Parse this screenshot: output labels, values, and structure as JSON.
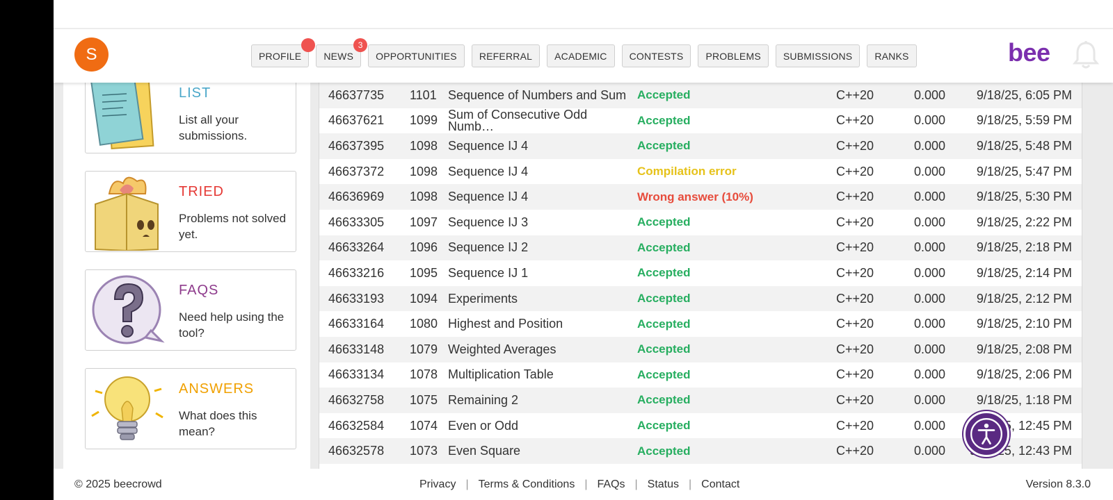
{
  "header": {
    "avatar_letter": "S",
    "logo": "bee",
    "nav": [
      {
        "label": "PROFILE",
        "badge": ""
      },
      {
        "label": "NEWS",
        "badge": "3"
      },
      {
        "label": "OPPORTUNITIES",
        "badge": ""
      },
      {
        "label": "REFERRAL",
        "badge": ""
      },
      {
        "label": "ACADEMIC",
        "badge": ""
      },
      {
        "label": "CONTESTS",
        "badge": ""
      },
      {
        "label": "PROBLEMS",
        "badge": ""
      },
      {
        "label": "SUBMISSIONS",
        "badge": ""
      },
      {
        "label": "RANKS",
        "badge": ""
      }
    ],
    "icons": {
      "bell": "bell-icon",
      "avatar": "user-avatar"
    }
  },
  "sidebar": {
    "cards": [
      {
        "title": "LIST",
        "desc": "List all your submissions.",
        "color": "#4aa7c9",
        "icon": "list-papers-icon"
      },
      {
        "title": "TRIED",
        "desc": "Problems not solved yet.",
        "color": "#e53935",
        "icon": "box-fire-icon"
      },
      {
        "title": "FAQS",
        "desc": "Need help using the tool?",
        "color": "#8e3b8c",
        "icon": "question-bubble-icon"
      },
      {
        "title": "ANSWERS",
        "desc": "What does this mean?",
        "color": "#f0a000",
        "icon": "lightbulb-icon"
      }
    ]
  },
  "submissions": [
    {
      "id": "46637735",
      "pid": "1101",
      "name": "Sequence of Numbers and Sum",
      "status": "Accepted",
      "status_type": "acc",
      "lang": "C++20",
      "time": "0.000",
      "date": "9/18/25, 6:05 PM"
    },
    {
      "id": "46637621",
      "pid": "1099",
      "name": "Sum of Consecutive Odd Numb…",
      "status": "Accepted",
      "status_type": "acc",
      "lang": "C++20",
      "time": "0.000",
      "date": "9/18/25, 5:59 PM"
    },
    {
      "id": "46637395",
      "pid": "1098",
      "name": "Sequence IJ 4",
      "status": "Accepted",
      "status_type": "acc",
      "lang": "C++20",
      "time": "0.000",
      "date": "9/18/25, 5:48 PM"
    },
    {
      "id": "46637372",
      "pid": "1098",
      "name": "Sequence IJ 4",
      "status": "Compilation error",
      "status_type": "ce",
      "lang": "C++20",
      "time": "0.000",
      "date": "9/18/25, 5:47 PM"
    },
    {
      "id": "46636969",
      "pid": "1098",
      "name": "Sequence IJ 4",
      "status": "Wrong answer (10%)",
      "status_type": "wa",
      "lang": "C++20",
      "time": "0.000",
      "date": "9/18/25, 5:30 PM"
    },
    {
      "id": "46633305",
      "pid": "1097",
      "name": "Sequence IJ 3",
      "status": "Accepted",
      "status_type": "acc",
      "lang": "C++20",
      "time": "0.000",
      "date": "9/18/25, 2:22 PM"
    },
    {
      "id": "46633264",
      "pid": "1096",
      "name": "Sequence IJ 2",
      "status": "Accepted",
      "status_type": "acc",
      "lang": "C++20",
      "time": "0.000",
      "date": "9/18/25, 2:18 PM"
    },
    {
      "id": "46633216",
      "pid": "1095",
      "name": "Sequence IJ 1",
      "status": "Accepted",
      "status_type": "acc",
      "lang": "C++20",
      "time": "0.000",
      "date": "9/18/25, 2:14 PM"
    },
    {
      "id": "46633193",
      "pid": "1094",
      "name": "Experiments",
      "status": "Accepted",
      "status_type": "acc",
      "lang": "C++20",
      "time": "0.000",
      "date": "9/18/25, 2:12 PM"
    },
    {
      "id": "46633164",
      "pid": "1080",
      "name": "Highest and Position",
      "status": "Accepted",
      "status_type": "acc",
      "lang": "C++20",
      "time": "0.000",
      "date": "9/18/25, 2:10 PM"
    },
    {
      "id": "46633148",
      "pid": "1079",
      "name": "Weighted Averages",
      "status": "Accepted",
      "status_type": "acc",
      "lang": "C++20",
      "time": "0.000",
      "date": "9/18/25, 2:08 PM"
    },
    {
      "id": "46633134",
      "pid": "1078",
      "name": "Multiplication Table",
      "status": "Accepted",
      "status_type": "acc",
      "lang": "C++20",
      "time": "0.000",
      "date": "9/18/25, 2:06 PM"
    },
    {
      "id": "46632758",
      "pid": "1075",
      "name": "Remaining 2",
      "status": "Accepted",
      "status_type": "acc",
      "lang": "C++20",
      "time": "0.000",
      "date": "9/18/25, 1:18 PM"
    },
    {
      "id": "46632584",
      "pid": "1074",
      "name": "Even or Odd",
      "status": "Accepted",
      "status_type": "acc",
      "lang": "C++20",
      "time": "0.000",
      "date": "9/18/25, 12:45 PM"
    },
    {
      "id": "46632578",
      "pid": "1073",
      "name": "Even Square",
      "status": "Accepted",
      "status_type": "acc",
      "lang": "C++20",
      "time": "0.000",
      "date": "9/18/25, 12:43 PM"
    }
  ],
  "footer": {
    "copyright": "© 2025 beecrowd",
    "links": [
      "Privacy",
      "Terms & Conditions",
      "FAQs",
      "Status",
      "Contact"
    ],
    "version": "Version 8.3.0"
  },
  "colors": {
    "brand": "#7b2fae",
    "accepted": "#27ae60",
    "compile_error": "#e6c21a",
    "wrong_answer": "#e74c3c",
    "avatar": "#f06c13",
    "accessibility": "#5a2a82"
  },
  "a11y_icon": "accessibility-icon"
}
